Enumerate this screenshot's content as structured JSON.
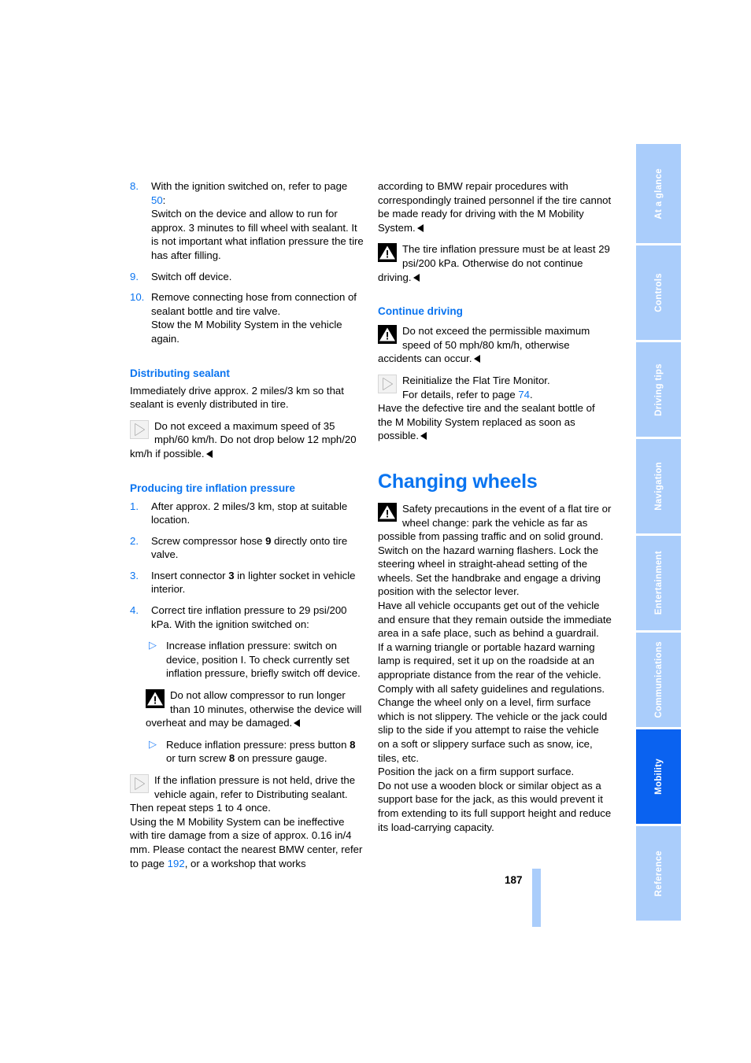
{
  "document": {
    "page_number": "187",
    "accent_blue": "#0a74f0",
    "tab_blue": "#aacdfb",
    "tab_active_blue": "#0a62f0"
  },
  "sidebar": {
    "tabs": [
      {
        "label": "At a glance",
        "active": false
      },
      {
        "label": "Controls",
        "active": false
      },
      {
        "label": "Driving tips",
        "active": false
      },
      {
        "label": "Navigation",
        "active": false
      },
      {
        "label": "Entertainment",
        "active": false
      },
      {
        "label": "Communications",
        "active": false
      },
      {
        "label": "Mobility",
        "active": true
      },
      {
        "label": "Reference",
        "active": false
      }
    ]
  },
  "left_column": {
    "steps_continued": [
      {
        "number": "8.",
        "text_before_link": "With the ignition switched on, refer to page ",
        "link": "50",
        "text_after_link": ":",
        "extra": "Switch on the device and allow to run for approx. 3 minutes to fill wheel with sealant. It is not important what inflation pressure the tire has after filling."
      },
      {
        "number": "9.",
        "text": "Switch off device."
      },
      {
        "number": "10.",
        "text": "Remove connecting hose from connection of sealant bottle and tire valve.",
        "extra": "Stow the M Mobility System in the vehicle again."
      }
    ],
    "distributing_sealant": {
      "heading": "Distributing sealant",
      "paragraph": "Immediately drive approx. 2 miles/3 km so that sealant is evenly distributed in tire.",
      "note": "Do not exceed a maximum speed of 35 mph/60 km/h. Do not drop below 12 mph/20 km/h if possible."
    },
    "producing_pressure": {
      "heading": "Producing tire inflation pressure",
      "steps": [
        {
          "number": "1.",
          "text": "After approx. 2 miles/3 km, stop at suitable location."
        },
        {
          "number": "2.",
          "text_a": "Screw compressor hose ",
          "bold": "9",
          "text_b": " directly onto tire valve."
        },
        {
          "number": "3.",
          "text_a": "Insert connector ",
          "bold": "3",
          "text_b": " in lighter socket in vehicle interior."
        },
        {
          "number": "4.",
          "text": "Correct tire inflation pressure to 29 psi/200 kPa. With the ignition switched on:"
        }
      ],
      "bullets": [
        {
          "text": "Increase inflation pressure: switch on device, position I. To check currently set inflation pressure, briefly switch off device."
        },
        {
          "text_a": "Reduce inflation pressure: press button ",
          "bold_1": "8",
          "text_b": " or turn screw ",
          "bold_2": "8",
          "text_c": " on pressure gauge."
        }
      ],
      "warning": "Do not allow compressor to run longer than 10 minutes, otherwise the device will overheat and may be damaged.",
      "note": "If the inflation pressure is not held, drive the vehicle again, refer to Distributing sealant. Then repeat steps 1 to 4 once.",
      "closing_before_link": "Using the M Mobility System can be ineffective with tire damage from a size of approx. 0.16 in/4 mm. Please contact the nearest BMW center, refer to page ",
      "closing_link": "192",
      "closing_after_link": ", or a workshop that works"
    }
  },
  "right_column": {
    "continuation": "according to BMW repair procedures with correspondingly trained personnel if the tire cannot be made ready for driving with the M Mobility System.",
    "pressure_warning": "The tire inflation pressure must be at least 29 psi/200 kPa. Otherwise do not continue driving.",
    "continue_driving": {
      "heading": "Continue driving",
      "warning": "Do not exceed the permissible maximum speed of 50 mph/80 km/h, otherwise accidents can occur.",
      "note_line_1": "Reinitialize the Flat Tire Monitor.",
      "note_line_2_before_link": "For details, refer to page ",
      "note_link": "74",
      "note_line_2_after_link": ".",
      "closing": "Have the defective tire and the sealant bottle of the M Mobility System replaced as soon as possible."
    },
    "changing_wheels": {
      "heading": "Changing wheels",
      "warning_paragraph_1": "Safety precautions in the event of a flat tire or wheel change: park the vehicle as far as possible from passing traffic and on solid ground. Switch on the hazard warning flashers. Lock the steering wheel in straight-ahead setting of the wheels. Set the handbrake and engage a driving position with the selector lever.",
      "paragraph_2": "Have all vehicle occupants get out of the vehicle and ensure that they remain outside the immediate area in a safe place, such as behind a guardrail.",
      "paragraph_3": "If a warning triangle or portable hazard warning lamp is required, set it up on the roadside at an appropriate distance from the rear of the vehicle. Comply with all safety guidelines and regulations.",
      "paragraph_4": "Change the wheel only on a level, firm surface which is not slippery. The vehicle or the jack could slip to the side if you attempt to raise the vehicle on a soft or slippery surface such as snow, ice, tiles, etc.",
      "paragraph_5": "Position the jack on a firm support surface.",
      "paragraph_6": "Do not use a wooden block or similar object as a support base for the jack, as this would prevent it from extending to its full support height and reduce its load-carrying capacity."
    }
  }
}
